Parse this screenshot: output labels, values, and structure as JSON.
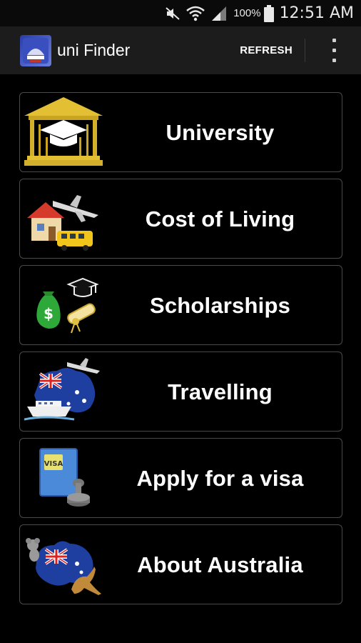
{
  "status_bar": {
    "battery_percent": "100%",
    "time": "12:51 AM",
    "icons": [
      "mute-icon",
      "wifi-icon",
      "signal-icon",
      "battery-icon"
    ]
  },
  "action_bar": {
    "app_title": "uni Finder",
    "refresh_label": "REFRESH",
    "overflow_icon": "overflow-menu-icon"
  },
  "menu": {
    "items": [
      {
        "label": "University",
        "icon": "university-building-icon"
      },
      {
        "label": "Cost of Living",
        "icon": "house-plane-bus-icon"
      },
      {
        "label": "Scholarships",
        "icon": "money-bag-graduation-icon"
      },
      {
        "label": "Travelling",
        "icon": "australia-flag-plane-ship-icon"
      },
      {
        "label": "Apply for a visa",
        "icon": "visa-stamp-icon"
      },
      {
        "label": "About Australia",
        "icon": "australia-map-koala-kangaroo-icon"
      }
    ]
  },
  "colors": {
    "background": "#000000",
    "action_bar": "#1c1c1c",
    "item_border": "#4a4a4a",
    "text": "#ffffff"
  }
}
